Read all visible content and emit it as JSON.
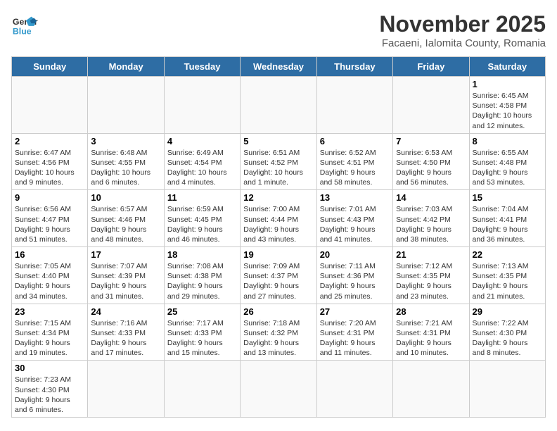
{
  "header": {
    "logo_general": "General",
    "logo_blue": "Blue",
    "title": "November 2025",
    "subtitle": "Facaeni, Ialomita County, Romania"
  },
  "days_of_week": [
    "Sunday",
    "Monday",
    "Tuesday",
    "Wednesday",
    "Thursday",
    "Friday",
    "Saturday"
  ],
  "weeks": [
    [
      {
        "day": "",
        "info": ""
      },
      {
        "day": "",
        "info": ""
      },
      {
        "day": "",
        "info": ""
      },
      {
        "day": "",
        "info": ""
      },
      {
        "day": "",
        "info": ""
      },
      {
        "day": "",
        "info": ""
      },
      {
        "day": "1",
        "info": "Sunrise: 6:45 AM\nSunset: 4:58 PM\nDaylight: 10 hours\nand 12 minutes."
      }
    ],
    [
      {
        "day": "2",
        "info": "Sunrise: 6:47 AM\nSunset: 4:56 PM\nDaylight: 10 hours\nand 9 minutes."
      },
      {
        "day": "3",
        "info": "Sunrise: 6:48 AM\nSunset: 4:55 PM\nDaylight: 10 hours\nand 6 minutes."
      },
      {
        "day": "4",
        "info": "Sunrise: 6:49 AM\nSunset: 4:54 PM\nDaylight: 10 hours\nand 4 minutes."
      },
      {
        "day": "5",
        "info": "Sunrise: 6:51 AM\nSunset: 4:52 PM\nDaylight: 10 hours\nand 1 minute."
      },
      {
        "day": "6",
        "info": "Sunrise: 6:52 AM\nSunset: 4:51 PM\nDaylight: 9 hours\nand 58 minutes."
      },
      {
        "day": "7",
        "info": "Sunrise: 6:53 AM\nSunset: 4:50 PM\nDaylight: 9 hours\nand 56 minutes."
      },
      {
        "day": "8",
        "info": "Sunrise: 6:55 AM\nSunset: 4:48 PM\nDaylight: 9 hours\nand 53 minutes."
      }
    ],
    [
      {
        "day": "9",
        "info": "Sunrise: 6:56 AM\nSunset: 4:47 PM\nDaylight: 9 hours\nand 51 minutes."
      },
      {
        "day": "10",
        "info": "Sunrise: 6:57 AM\nSunset: 4:46 PM\nDaylight: 9 hours\nand 48 minutes."
      },
      {
        "day": "11",
        "info": "Sunrise: 6:59 AM\nSunset: 4:45 PM\nDaylight: 9 hours\nand 46 minutes."
      },
      {
        "day": "12",
        "info": "Sunrise: 7:00 AM\nSunset: 4:44 PM\nDaylight: 9 hours\nand 43 minutes."
      },
      {
        "day": "13",
        "info": "Sunrise: 7:01 AM\nSunset: 4:43 PM\nDaylight: 9 hours\nand 41 minutes."
      },
      {
        "day": "14",
        "info": "Sunrise: 7:03 AM\nSunset: 4:42 PM\nDaylight: 9 hours\nand 38 minutes."
      },
      {
        "day": "15",
        "info": "Sunrise: 7:04 AM\nSunset: 4:41 PM\nDaylight: 9 hours\nand 36 minutes."
      }
    ],
    [
      {
        "day": "16",
        "info": "Sunrise: 7:05 AM\nSunset: 4:40 PM\nDaylight: 9 hours\nand 34 minutes."
      },
      {
        "day": "17",
        "info": "Sunrise: 7:07 AM\nSunset: 4:39 PM\nDaylight: 9 hours\nand 31 minutes."
      },
      {
        "day": "18",
        "info": "Sunrise: 7:08 AM\nSunset: 4:38 PM\nDaylight: 9 hours\nand 29 minutes."
      },
      {
        "day": "19",
        "info": "Sunrise: 7:09 AM\nSunset: 4:37 PM\nDaylight: 9 hours\nand 27 minutes."
      },
      {
        "day": "20",
        "info": "Sunrise: 7:11 AM\nSunset: 4:36 PM\nDaylight: 9 hours\nand 25 minutes."
      },
      {
        "day": "21",
        "info": "Sunrise: 7:12 AM\nSunset: 4:35 PM\nDaylight: 9 hours\nand 23 minutes."
      },
      {
        "day": "22",
        "info": "Sunrise: 7:13 AM\nSunset: 4:35 PM\nDaylight: 9 hours\nand 21 minutes."
      }
    ],
    [
      {
        "day": "23",
        "info": "Sunrise: 7:15 AM\nSunset: 4:34 PM\nDaylight: 9 hours\nand 19 minutes."
      },
      {
        "day": "24",
        "info": "Sunrise: 7:16 AM\nSunset: 4:33 PM\nDaylight: 9 hours\nand 17 minutes."
      },
      {
        "day": "25",
        "info": "Sunrise: 7:17 AM\nSunset: 4:33 PM\nDaylight: 9 hours\nand 15 minutes."
      },
      {
        "day": "26",
        "info": "Sunrise: 7:18 AM\nSunset: 4:32 PM\nDaylight: 9 hours\nand 13 minutes."
      },
      {
        "day": "27",
        "info": "Sunrise: 7:20 AM\nSunset: 4:31 PM\nDaylight: 9 hours\nand 11 minutes."
      },
      {
        "day": "28",
        "info": "Sunrise: 7:21 AM\nSunset: 4:31 PM\nDaylight: 9 hours\nand 10 minutes."
      },
      {
        "day": "29",
        "info": "Sunrise: 7:22 AM\nSunset: 4:30 PM\nDaylight: 9 hours\nand 8 minutes."
      }
    ],
    [
      {
        "day": "30",
        "info": "Sunrise: 7:23 AM\nSunset: 4:30 PM\nDaylight: 9 hours\nand 6 minutes."
      },
      {
        "day": "",
        "info": ""
      },
      {
        "day": "",
        "info": ""
      },
      {
        "day": "",
        "info": ""
      },
      {
        "day": "",
        "info": ""
      },
      {
        "day": "",
        "info": ""
      },
      {
        "day": "",
        "info": ""
      }
    ]
  ]
}
